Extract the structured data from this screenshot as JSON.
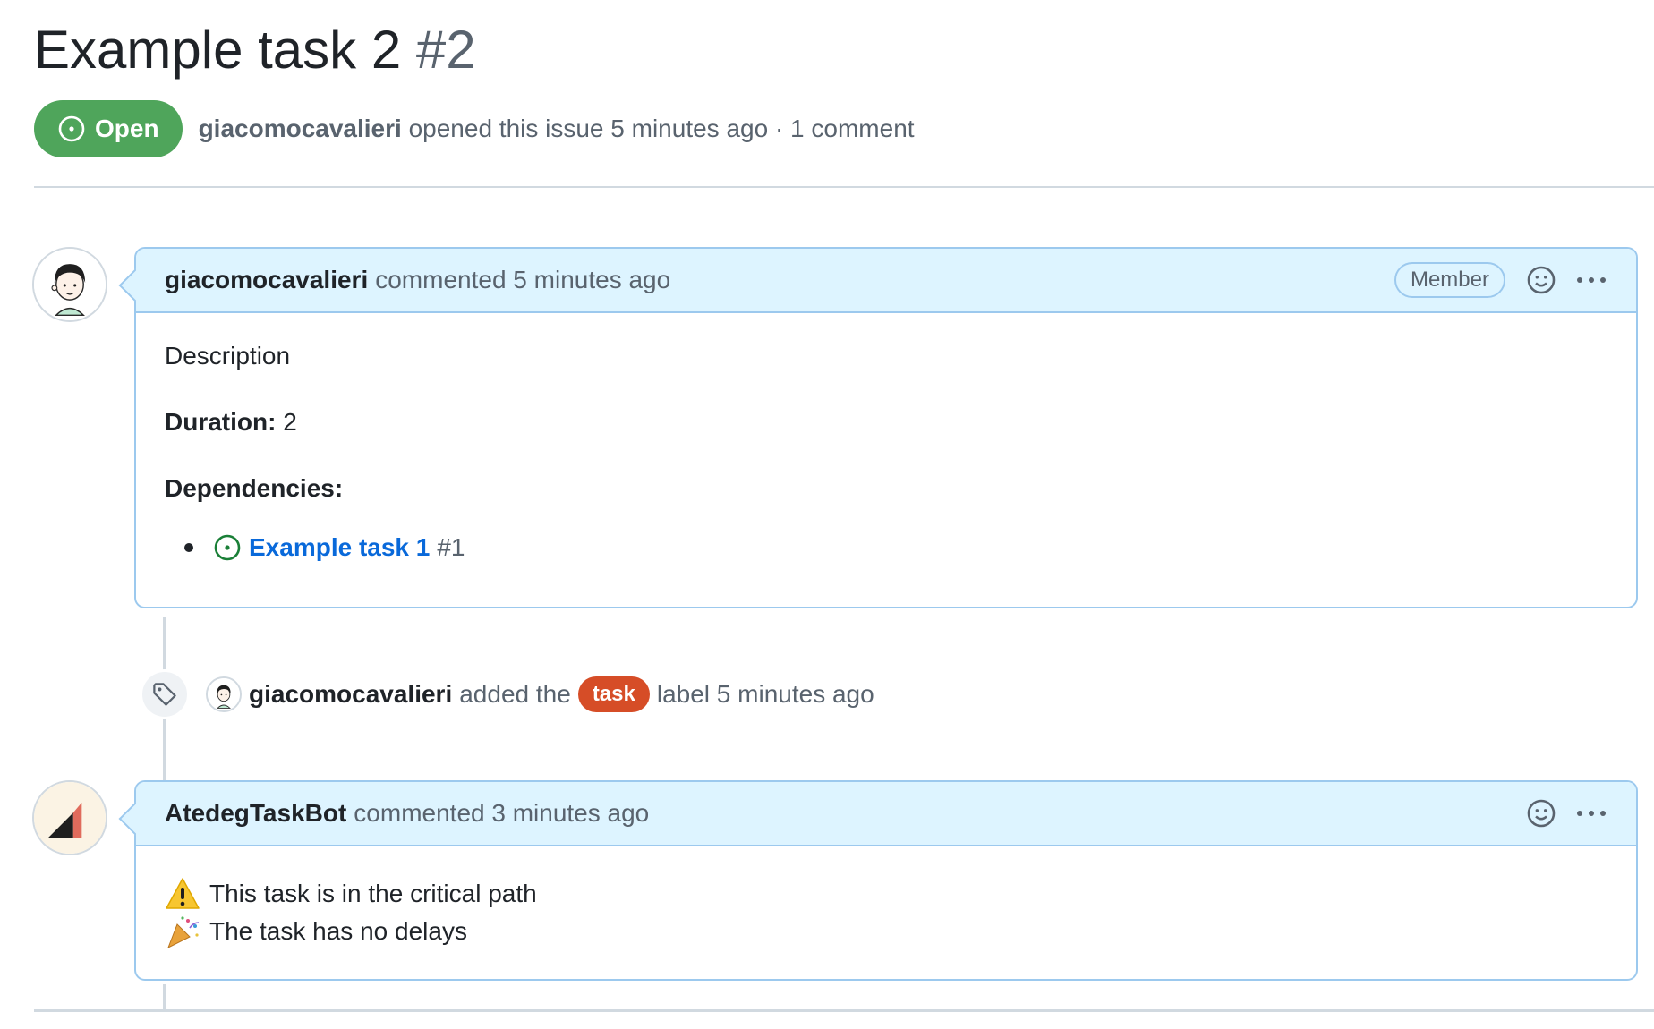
{
  "issue": {
    "title": "Example task 2",
    "number": "#2",
    "state_label": "Open",
    "state_color": "#4fa55b",
    "author": "giacomocavalieri",
    "meta_text": "opened this issue 5 minutes ago · 1 comment"
  },
  "timeline": {
    "comment1": {
      "author": "giacomocavalieri",
      "action": "commented 5 minutes ago",
      "badge": "Member",
      "header_icons": [
        "smiley-icon",
        "kebab-horizontal-icon"
      ],
      "body": {
        "description": "Description",
        "duration_label": "Duration:",
        "duration_value": "2",
        "dependencies_label": "Dependencies:",
        "dependencies": [
          {
            "title": "Example task 1",
            "number": "#1",
            "state_icon": "issue-open-icon"
          }
        ]
      }
    },
    "event": {
      "icon": "tag-icon",
      "author": "giacomocavalieri",
      "text_before": "added the",
      "label": "task",
      "label_color": "#d64d27",
      "text_after": "label 5 minutes ago"
    },
    "comment2": {
      "author": "AtedegTaskBot",
      "action": "commented 3 minutes ago",
      "header_icons": [
        "smiley-icon",
        "kebab-horizontal-icon"
      ],
      "lines": [
        {
          "emoji": "warning-emoji",
          "text": "This task is in the critical path"
        },
        {
          "emoji": "party-popper-emoji",
          "text": "The task has no delays"
        }
      ]
    }
  },
  "colors": {
    "accent_link": "#0969da",
    "comment_border": "#9cc9ee",
    "comment_header_bg": "#ddf4ff",
    "muted_text": "#59636e"
  }
}
